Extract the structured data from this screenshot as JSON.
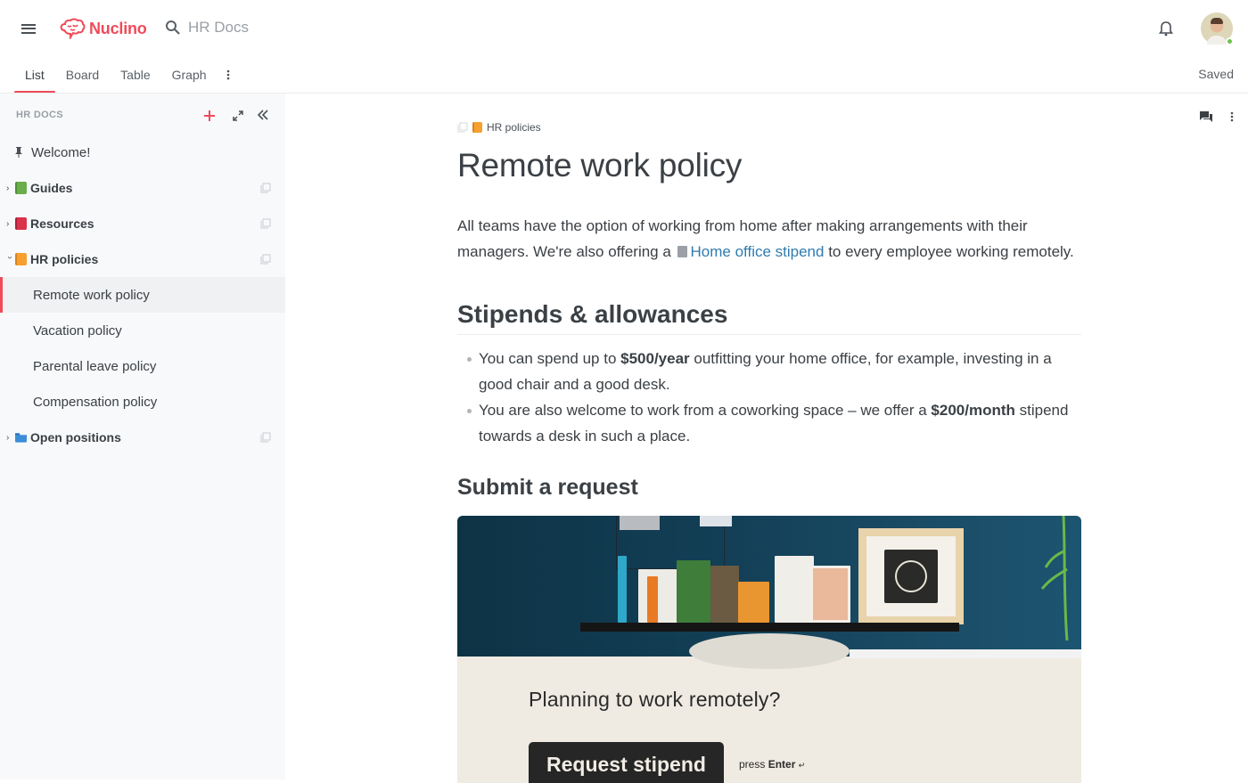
{
  "topbar": {
    "brand": "Nuclino",
    "brand_color": "#ef4b5a",
    "search_placeholder": "HR Docs",
    "icons": {
      "menu": "hamburger-icon",
      "search": "search-icon",
      "notifications": "bell-icon"
    },
    "user_status": "online"
  },
  "view_tabs": [
    {
      "label": "List",
      "active": true
    },
    {
      "label": "Board",
      "active": false
    },
    {
      "label": "Table",
      "active": false
    },
    {
      "label": "Graph",
      "active": false
    }
  ],
  "save_status": "Saved",
  "sidebar": {
    "workspace": "HR DOCS",
    "items": [
      {
        "label": "Welcome!",
        "type": "pinned"
      },
      {
        "label": "Guides",
        "type": "collection",
        "color": "#6aad4c",
        "expanded": false
      },
      {
        "label": "Resources",
        "type": "collection",
        "color": "#d9324a",
        "expanded": false
      },
      {
        "label": "HR policies",
        "type": "collection",
        "color": "#f5a030",
        "expanded": true
      },
      {
        "label": "Remote work policy",
        "type": "item",
        "active": true
      },
      {
        "label": "Vacation policy",
        "type": "item"
      },
      {
        "label": "Parental leave policy",
        "type": "item"
      },
      {
        "label": "Compensation policy",
        "type": "item"
      },
      {
        "label": "Open positions",
        "type": "folder",
        "color": "#3d8ed8",
        "expanded": false
      }
    ]
  },
  "document": {
    "breadcrumb": "HR policies",
    "title": "Remote work policy",
    "intro_before": "All teams have the option of working from home after making arrangements with their managers. We're also offering a ",
    "intro_link": "Home office stipend",
    "intro_after": " to every employee working remotely.",
    "section1_heading": "Stipends & allowances",
    "bullets": [
      {
        "before": "You can spend up to ",
        "bold": "$500/year",
        "after": " outfitting your home office, for example, investing in a good chair and a good desk."
      },
      {
        "before": "You are also welcome to work from a coworking space – we offer a ",
        "bold": "$200/month",
        "after": " stipend towards a desk in such a place."
      }
    ],
    "section2_heading": "Submit a request",
    "embed": {
      "question": "Planning to work remotely?",
      "button": "Request stipend",
      "hint_prefix": "press ",
      "hint_key": "Enter",
      "hint_symbol": "↵"
    }
  }
}
